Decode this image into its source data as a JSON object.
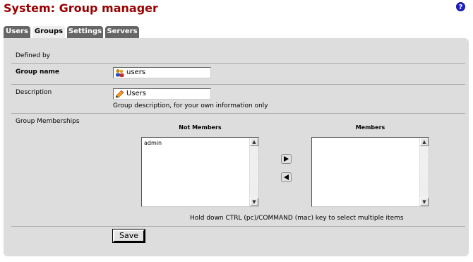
{
  "header": {
    "title": "System: Group manager",
    "help_icon": "?"
  },
  "tabs": [
    {
      "label": "Users",
      "active": false
    },
    {
      "label": "Groups",
      "active": true
    },
    {
      "label": "Settings",
      "active": false
    },
    {
      "label": "Servers",
      "active": false
    }
  ],
  "form": {
    "defined_by_label": "Defined by",
    "group_name_label": "Group name",
    "group_name_value": "users",
    "description_label": "Description",
    "description_value": "Users",
    "description_hint": "Group description, for your own information only",
    "memberships_label": "Group Memberships",
    "not_members_label": "Not Members",
    "not_members_items": [
      "admin"
    ],
    "members_label": "Members",
    "members_items": [],
    "multi_select_hint": "Hold down CTRL (pc)/COMMAND (mac) key to select multiple items",
    "save_label": "Save"
  },
  "icons": {
    "help": "help-icon",
    "group_name_field": "users-icon",
    "description_field": "pencil-icon",
    "add": "arrow-right-icon",
    "remove": "arrow-left-icon"
  },
  "colors": {
    "title": "#990000",
    "tab": "#666666",
    "panel": "#dddddd",
    "help": "#1f1fd0"
  }
}
